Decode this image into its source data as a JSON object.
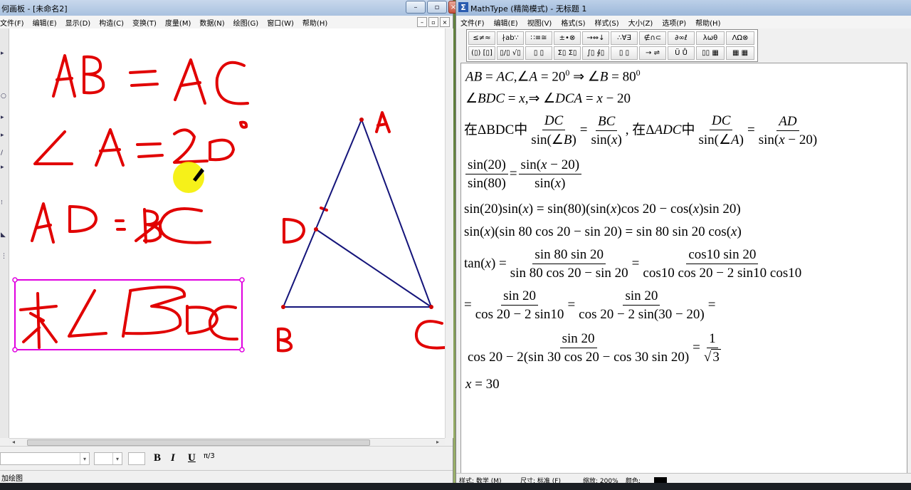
{
  "gsp": {
    "title": "何画板 - [未命名2]",
    "menu": [
      "文件(F)",
      "编辑(E)",
      "显示(D)",
      "构造(C)",
      "变换(T)",
      "度量(M)",
      "数据(N)",
      "绘图(G)",
      "窗口(W)",
      "帮助(H)"
    ],
    "status": "加绘图",
    "points": {
      "A": "A",
      "B": "B",
      "C": "C",
      "D": "D"
    },
    "format": {
      "bold": "B",
      "italic": "I",
      "underline": "U"
    }
  },
  "mathtype": {
    "title": "MathType (精简模式) - 无标题 1",
    "menu": [
      "文件(F)",
      "编辑(E)",
      "视图(V)",
      "格式(S)",
      "样式(S)",
      "大小(Z)",
      "选项(P)",
      "帮助(H)"
    ],
    "palette_row1": [
      "≤≠≈",
      "∤ab∵",
      "∷≡≅",
      "±•⊗",
      "→⇔↓",
      "∴∀∃",
      "∉∩⊂",
      "∂∞ℓ",
      "λωθ",
      "ΛΩ⊗"
    ],
    "palette_row2": [
      "(▯) [▯]",
      "▯/▯ √▯",
      "▯ ▯",
      "Σ▯ Σ▯",
      "∫▯ ∮▯",
      "▯ ▯",
      "→ ⇌",
      "Ü Ů",
      "▯▯ ▦",
      "▦ ▦"
    ],
    "status": {
      "style": "样式: 数学 (M)",
      "size": "尺寸: 标准 (F)",
      "zoom": "缩放: 200%",
      "color": "颜色:"
    }
  }
}
